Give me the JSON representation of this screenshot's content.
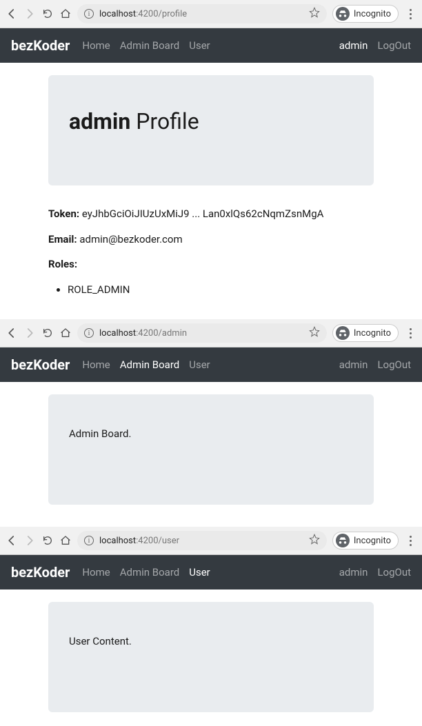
{
  "screens": [
    {
      "url_host": "localhost",
      "url_port": ":4200",
      "url_path": "/profile",
      "incognito_label": "Incognito",
      "brand": "bezKoder",
      "nav": [
        {
          "label": "Home",
          "active": false
        },
        {
          "label": "Admin Board",
          "active": false
        },
        {
          "label": "User",
          "active": false
        }
      ],
      "nav_right": [
        {
          "label": "admin",
          "active": true
        },
        {
          "label": "LogOut",
          "active": false
        }
      ],
      "profile": {
        "name": "admin",
        "suffix": "Profile",
        "token_label": "Token:",
        "token_value": "eyJhbGciOiJIUzUxMiJ9 ... Lan0xlQs62cNqmZsnMgA",
        "email_label": "Email:",
        "email_value": "admin@bezkoder.com",
        "roles_label": "Roles:",
        "roles": [
          "ROLE_ADMIN"
        ]
      }
    },
    {
      "url_host": "localhost",
      "url_port": ":4200",
      "url_path": "/admin",
      "incognito_label": "Incognito",
      "brand": "bezKoder",
      "nav": [
        {
          "label": "Home",
          "active": false
        },
        {
          "label": "Admin Board",
          "active": true
        },
        {
          "label": "User",
          "active": false
        }
      ],
      "nav_right": [
        {
          "label": "admin",
          "active": false
        },
        {
          "label": "LogOut",
          "active": false
        }
      ],
      "content": "Admin Board."
    },
    {
      "url_host": "localhost",
      "url_port": ":4200",
      "url_path": "/user",
      "incognito_label": "Incognito",
      "brand": "bezKoder",
      "nav": [
        {
          "label": "Home",
          "active": false
        },
        {
          "label": "Admin Board",
          "active": false
        },
        {
          "label": "User",
          "active": true
        }
      ],
      "nav_right": [
        {
          "label": "admin",
          "active": false
        },
        {
          "label": "LogOut",
          "active": false
        }
      ],
      "content": "User Content."
    }
  ]
}
